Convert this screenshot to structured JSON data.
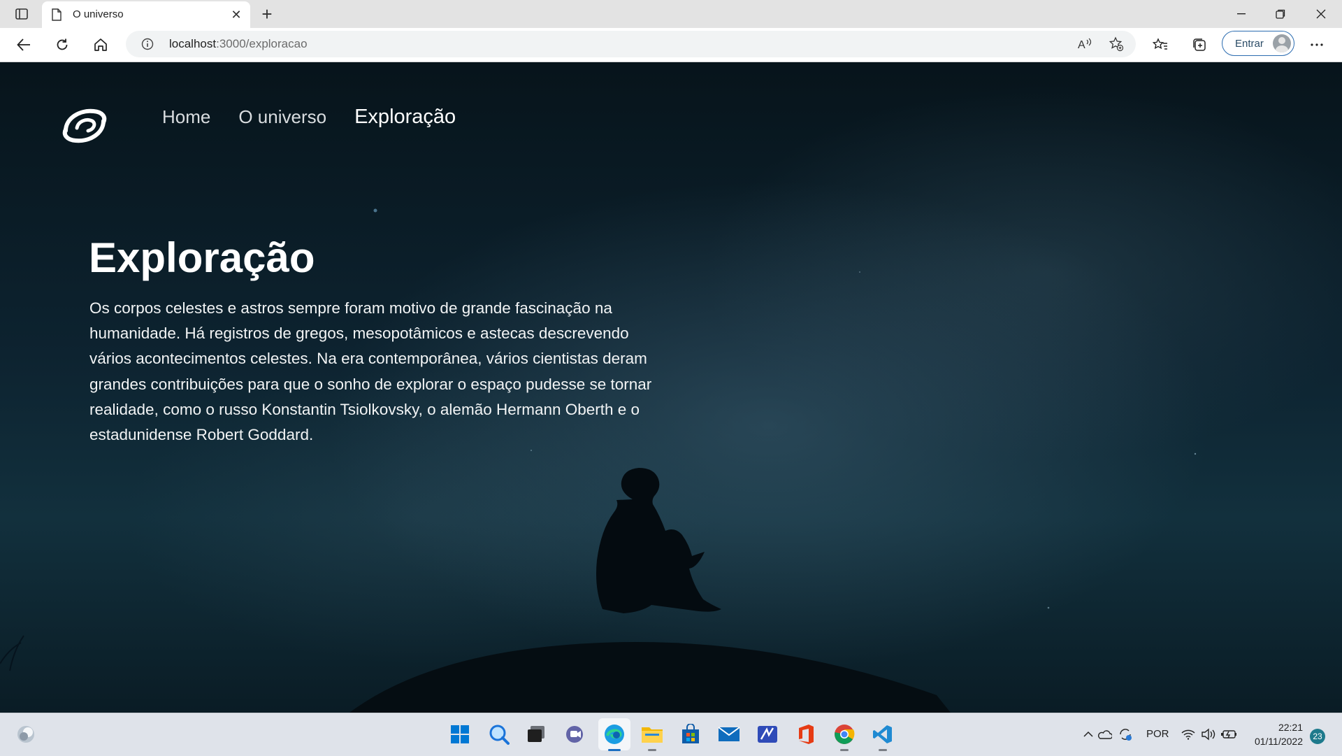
{
  "browser": {
    "tab_title": "O universo",
    "url_host": "localhost",
    "url_rest": ":3000/exploracao",
    "signin_label": "Entrar"
  },
  "site": {
    "nav": [
      {
        "label": "Home",
        "active": false
      },
      {
        "label": "O universo",
        "active": false
      },
      {
        "label": "Exploração",
        "active": true
      }
    ],
    "hero_title": "Exploração",
    "hero_text": "Os corpos celestes e astros sempre foram motivo de grande fascinação na humanidade. Há registros de gregos, mesopotâmicos e astecas descrevendo vários acontecimentos celestes. Na era contemporânea, vários cientistas deram grandes contribuições para que o sonho de explorar o espaço pudesse se tornar realidade, como o russo Konstantin Tsiolkovsky, o alemão Hermann Oberth e o estadunidense Robert Goddard."
  },
  "taskbar": {
    "language": "POR",
    "time": "22:21",
    "date": "01/11/2022",
    "notifications": "23"
  },
  "icons": {
    "tab_actions": "tab-actions-icon",
    "back": "back-arrow-icon",
    "reload": "reload-icon",
    "home": "home-icon",
    "site_info": "info-icon",
    "read_aloud": "read-aloud-icon",
    "favorite_add": "star-add-icon",
    "favorites": "favorites-icon",
    "collections": "collections-icon",
    "more": "more-icon"
  }
}
